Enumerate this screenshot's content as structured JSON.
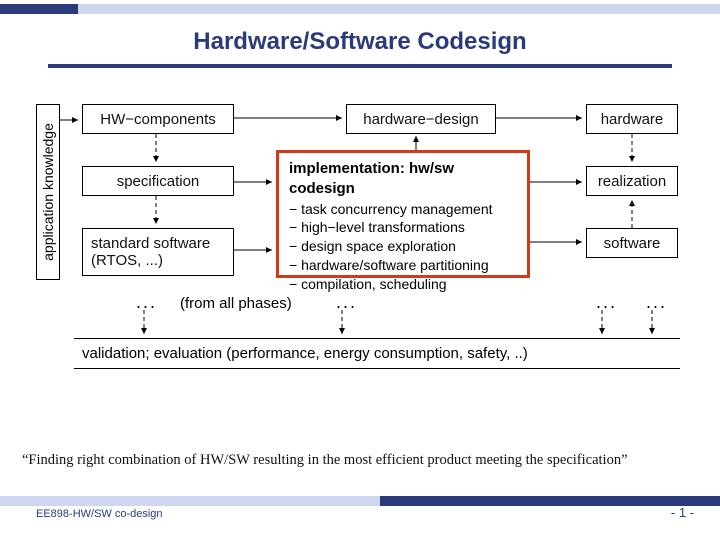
{
  "title": "Hardware/Software Codesign",
  "sidebar_label": "application knowledge",
  "boxes": {
    "hw_components": "HW−components",
    "specification": "specification",
    "standard_sw": "standard software\n(RTOS, ...)",
    "hardware_design": "hardware−design",
    "hardware": "hardware",
    "realization": "realization",
    "software": "software"
  },
  "impl": {
    "header": "implementation: hw/sw codesign",
    "items": [
      "− task concurrency management",
      "− high−level transformations",
      "− design space exploration",
      "− hardware/software partitioning",
      "− compilation, scheduling"
    ]
  },
  "flow_label": "(from all phases)",
  "validation": "validation; evaluation (performance, energy consumption, safety, ..)",
  "caption": "“Finding right combination of HW/SW resulting in the most efficient product meeting the specification”",
  "footer_course": "EE898-HW/SW co-design",
  "footer_page": "-  1  -"
}
